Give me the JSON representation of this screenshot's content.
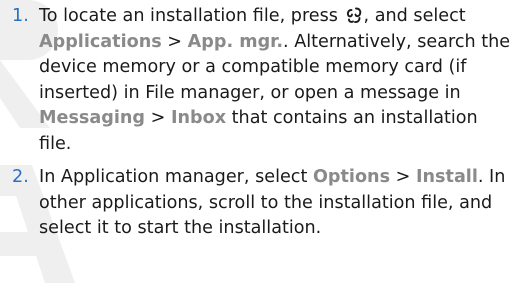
{
  "steps": [
    {
      "number": "1.",
      "t1": "To locate an installation file, press",
      "t2": ", and select",
      "u1": "Applications",
      "s1": ">",
      "u2": "App. mgr.",
      "t3": ". Alternatively, search the device memory or a compatible memory card (if inserted) in File manager, or open a message in",
      "u3": "Messaging",
      "s2": ">",
      "u4": "Inbox",
      "t4": "that contains an installation file."
    },
    {
      "number": "2.",
      "t1": "In Application manager, select",
      "u1": "Options",
      "s1": ">",
      "u2": "Install",
      "t2": ". In other applications, scroll to the installation file, and select it to start the installation."
    }
  ],
  "icons": {
    "menu_key": "menu-key-icon"
  },
  "colors": {
    "step_number": "#2b6fc2",
    "ui_term": "#8a8a8a",
    "watermark": "#efefef"
  }
}
